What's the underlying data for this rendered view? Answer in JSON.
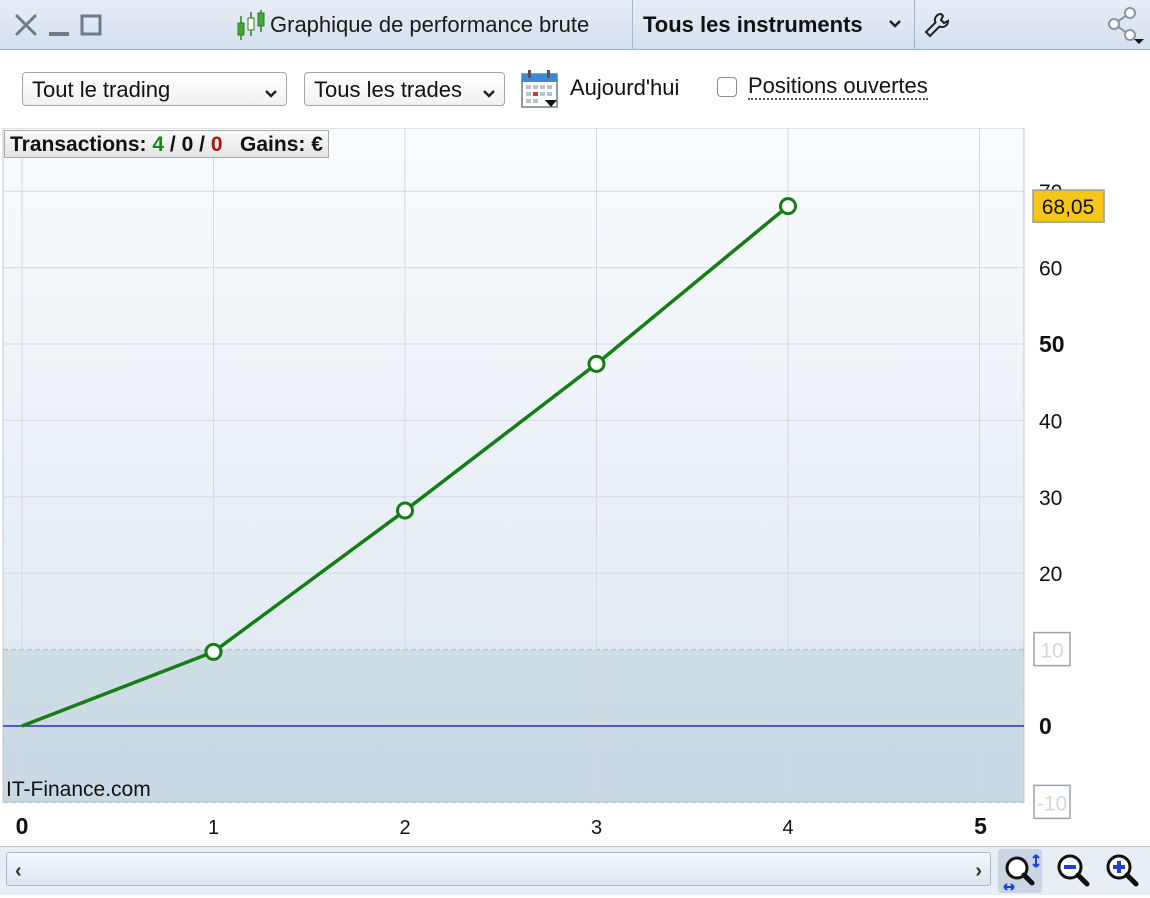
{
  "window": {
    "title": "Graphique de performance brute",
    "instrument_menu": "Tous les instruments"
  },
  "toolbar": {
    "trading_select": "Tout le trading",
    "trades_select": "Tous les trades",
    "today_label": "Aujourd'hui",
    "open_positions_label": "Positions ouvertes",
    "open_positions_checked": false
  },
  "info": {
    "transactions_label": "Transactions:",
    "tx_win": "4",
    "tx_sep1": "/",
    "tx_flat": "0",
    "tx_sep2": "/",
    "tx_loss": "0",
    "gains_label": "Gains:",
    "currency": "€"
  },
  "watermark": "IT-Finance.com",
  "colors": {
    "line": "#147d14",
    "zero_line": "#2b2bc8",
    "value_badge": "#f5c518",
    "panel_bg": "#dde9f2"
  },
  "chart_data": {
    "type": "line",
    "x": [
      0,
      1,
      2,
      3,
      4
    ],
    "series": [
      {
        "values": [
          0,
          9.7,
          28.2,
          47.4,
          68.05
        ]
      }
    ],
    "xlim": [
      0,
      5.2
    ],
    "ylim": [
      -10,
      70
    ],
    "x_ticks": [
      "0",
      "1",
      "2",
      "3",
      "4",
      "5"
    ],
    "x_major_ticks": [
      "0",
      "5"
    ],
    "y_ticks": [
      "70",
      "60",
      "50",
      "40",
      "30",
      "20",
      "10",
      "0",
      "-10"
    ],
    "y_major_ticks": [
      "50",
      "0"
    ],
    "y_boxed_ticks": [
      "10",
      "-10"
    ],
    "last_value_label": "68,05",
    "reference_lines": [
      0
    ],
    "shaded_band": [
      -10,
      10
    ],
    "grid": true
  }
}
